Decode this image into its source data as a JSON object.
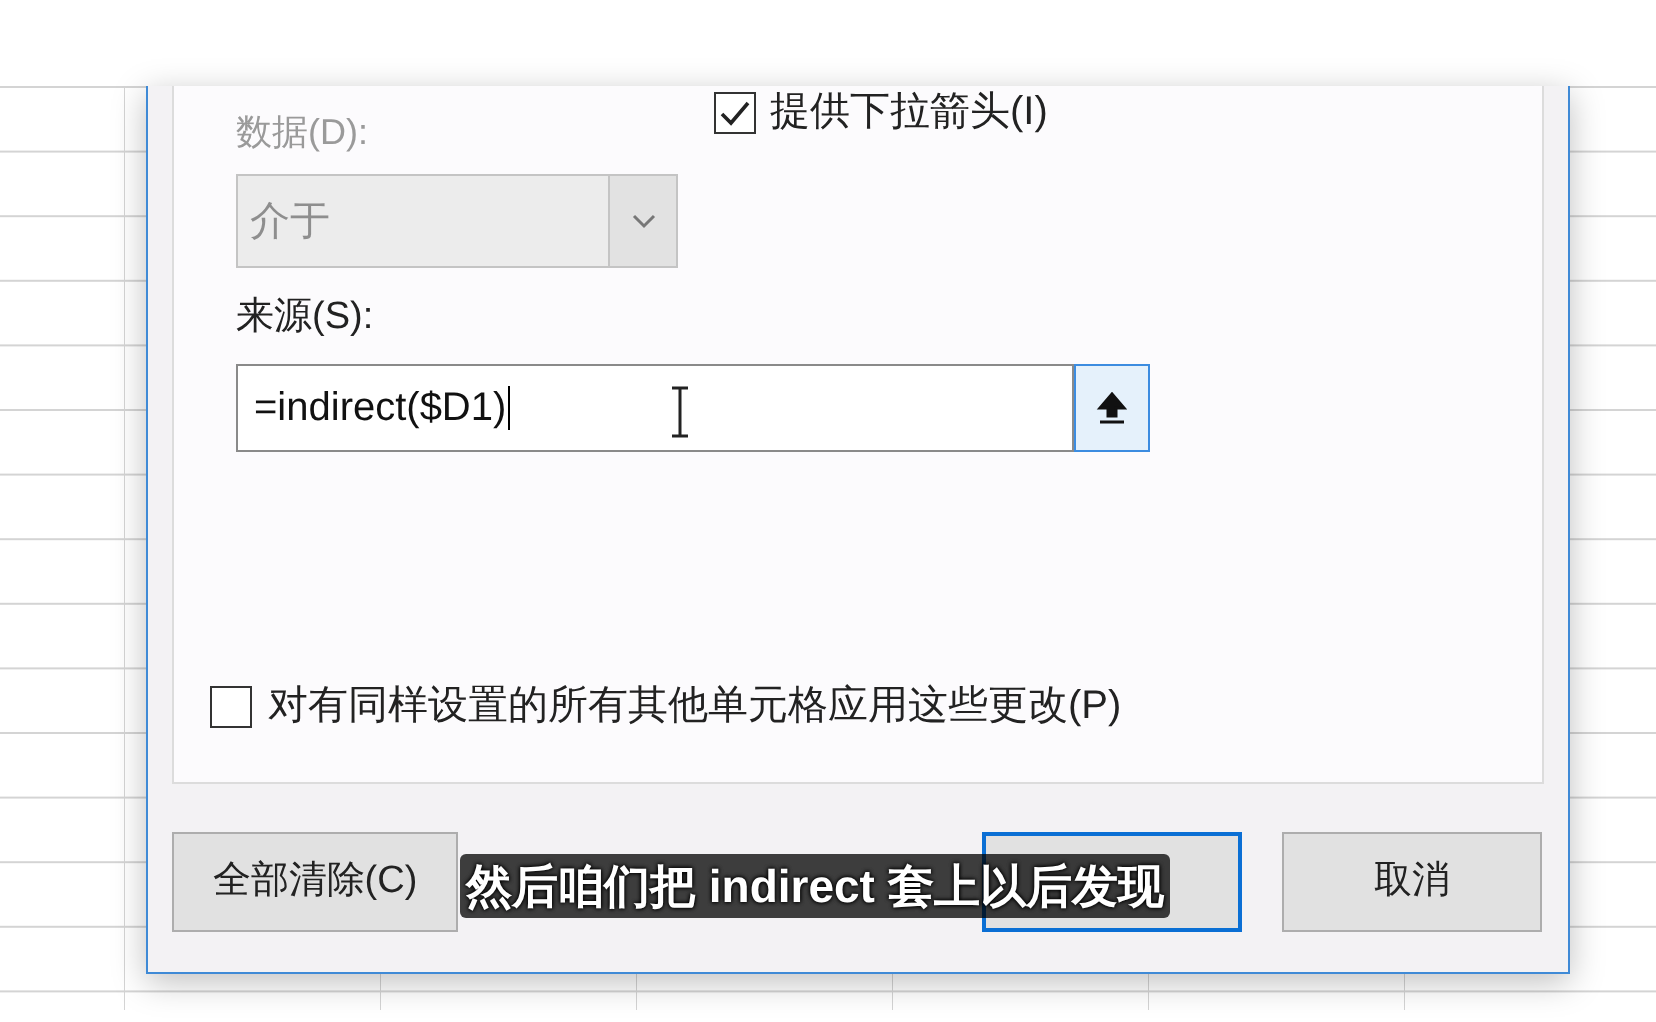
{
  "dialog": {
    "dropdown_arrow_checkbox": {
      "label": "提供下拉箭头(I)",
      "checked": true
    },
    "data_field": {
      "label": "数据(D):",
      "value": "介于",
      "disabled": true
    },
    "source_field": {
      "label": "来源(S):",
      "value": "=indirect($D1)"
    },
    "apply_all_checkbox": {
      "label": "对有同样设置的所有其他单元格应用这些更改(P)",
      "checked": false
    },
    "buttons": [
      {
        "kind": "clear",
        "label": "全部清除(C)",
        "default": false
      },
      {
        "kind": "ok",
        "default": true
      },
      {
        "kind": "cancel",
        "label": "取消",
        "default": false
      }
    ]
  },
  "subtitle": "然后咱们把 indirect 套上以后发现"
}
